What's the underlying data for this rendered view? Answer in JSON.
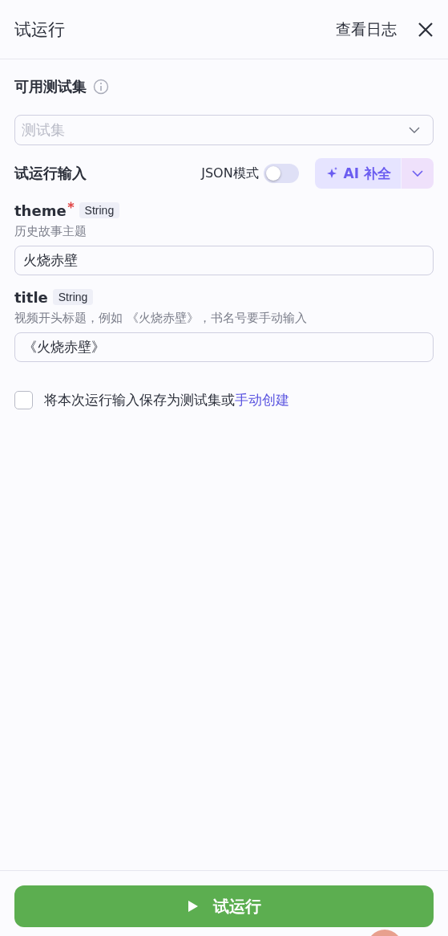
{
  "header": {
    "title": "试运行",
    "log_link": "查看日志"
  },
  "test_set": {
    "label": "可用测试集",
    "placeholder": "测试集"
  },
  "input_section": {
    "label": "试运行输入",
    "json_mode": {
      "label": "JSON模式",
      "on": false
    },
    "ai_button": "AI 补全"
  },
  "params": [
    {
      "name": "theme",
      "required": true,
      "type": "String",
      "description": "历史故事主题",
      "value": "火烧赤壁"
    },
    {
      "name": "title",
      "required": false,
      "type": "String",
      "description": "视频开头标题，例如 《火烧赤壁》，书名号要手动输入",
      "value": "《火烧赤壁》"
    }
  ],
  "save_option": {
    "checked": false,
    "text": "将本次运行输入保存为测试集或",
    "link": "手动创建"
  },
  "run_button": "试运行"
}
